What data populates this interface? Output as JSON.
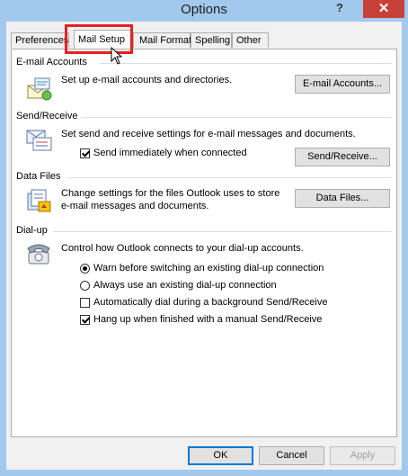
{
  "window": {
    "title": "Options",
    "help": "?",
    "close": "✕"
  },
  "tabs": [
    {
      "label": "Preferences"
    },
    {
      "label": "Mail Setup"
    },
    {
      "label": "Mail Format"
    },
    {
      "label": "Spelling"
    },
    {
      "label": "Other"
    }
  ],
  "email_accounts": {
    "title": "E-mail Accounts",
    "description": "Set up e-mail accounts and directories.",
    "button": "E-mail Accounts..."
  },
  "send_receive": {
    "title": "Send/Receive",
    "description": "Set send and receive settings for e-mail messages and documents.",
    "checkbox_label": "Send immediately when connected",
    "checkbox_checked": true,
    "button": "Send/Receive..."
  },
  "data_files": {
    "title": "Data Files",
    "description_line1": "Change settings for the files Outlook uses to store",
    "description_line2": "e-mail messages and documents.",
    "button": "Data Files..."
  },
  "dialup": {
    "title": "Dial-up",
    "description": "Control how Outlook connects to your dial-up accounts.",
    "radio_warn": "Warn before switching an existing dial-up connection",
    "radio_always": "Always use an existing dial-up connection",
    "check_autodial": "Automatically dial during a background Send/Receive",
    "check_hangup": "Hang up when finished with a manual Send/Receive"
  },
  "footer": {
    "ok": "OK",
    "cancel": "Cancel",
    "apply": "Apply"
  },
  "colors": {
    "titlebar": "#a2c8ed",
    "close": "#c7413a",
    "highlight": "#e62020"
  }
}
